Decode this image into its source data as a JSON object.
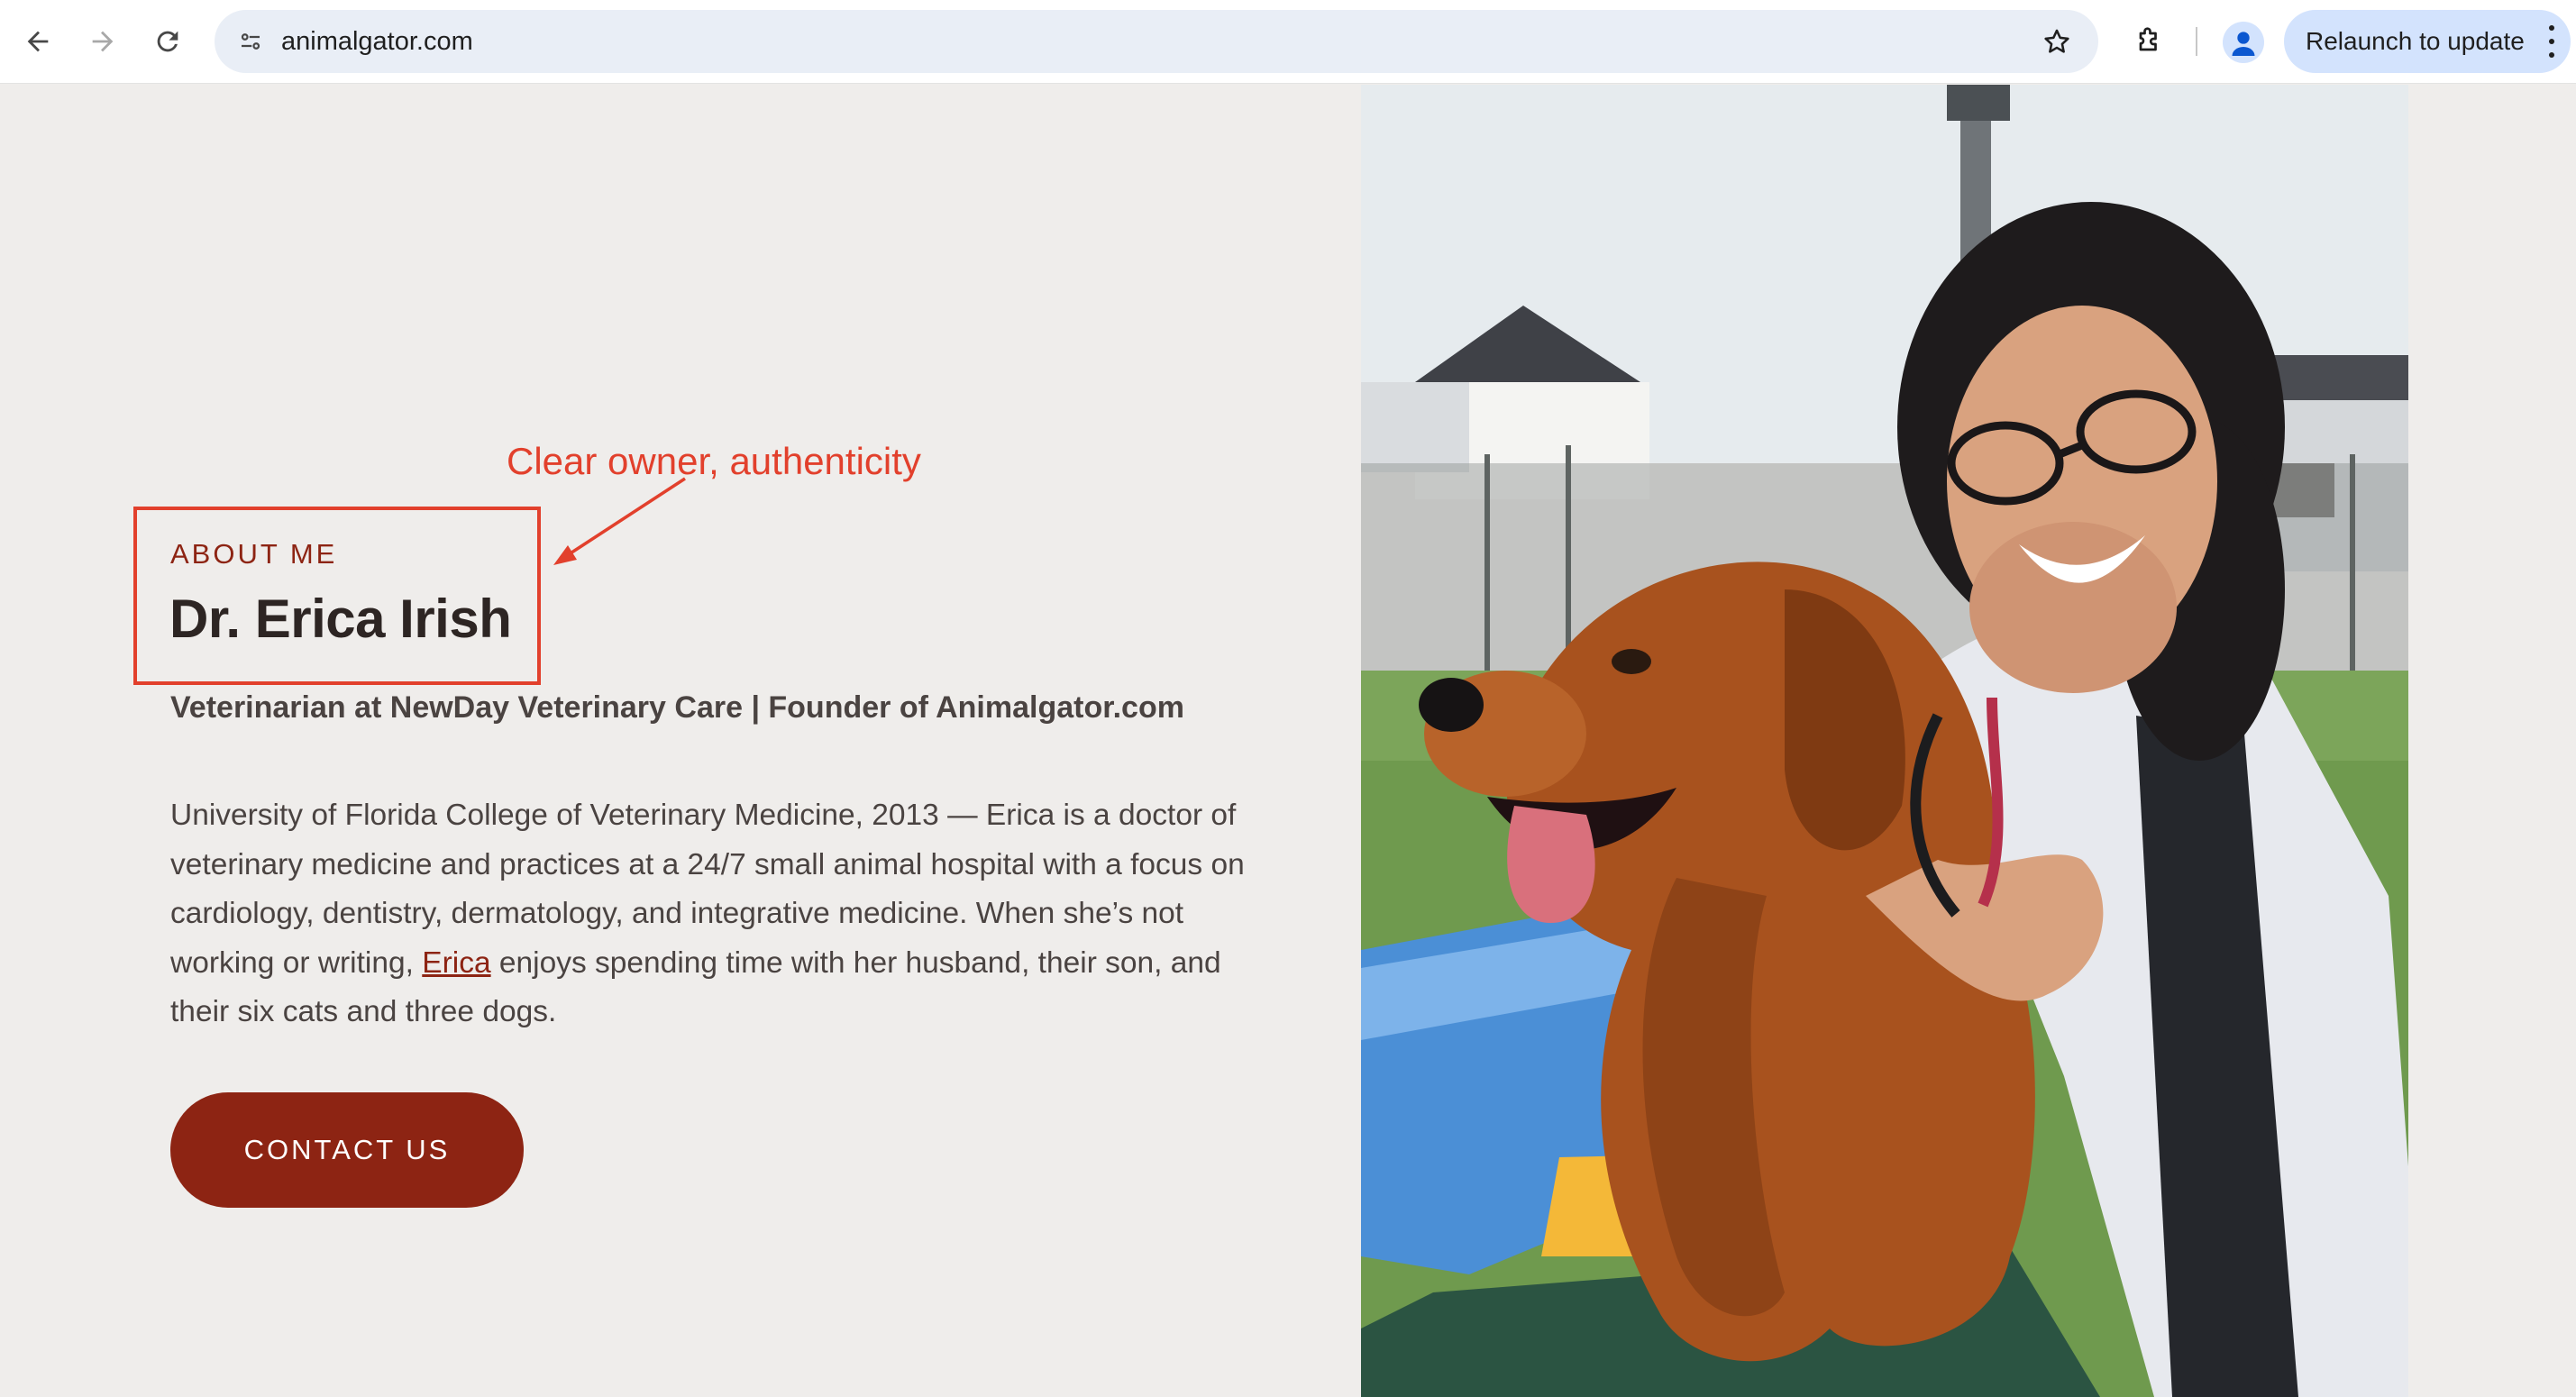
{
  "browser": {
    "url": "animalgator.com",
    "relaunch_label": "Relaunch to update"
  },
  "annotation": {
    "text": "Clear owner, authenticity",
    "color": "#e2402c"
  },
  "about": {
    "eyebrow": "ABOUT ME",
    "name": "Dr. Erica Irish",
    "role": "Veterinarian at NewDay Veterinary Care | Founder of Animalgator.com",
    "bio_before_link": "University of Florida College of Veterinary Medicine, 2013 — Erica is a doctor of veterinary medicine and practices at a 24/7 small animal hospital with a focus on cardiology, dentistry, dermatology, and integrative medicine. When she’s not working or writing, ",
    "bio_link": "Erica",
    "bio_after_link": " enjoys spending time with her husband, their son, and their six cats and three dogs.",
    "contact_label": "CONTACT US"
  },
  "colors": {
    "accent": "#8d2413",
    "page_bg": "#efedeb",
    "annotation": "#e2402c"
  },
  "icons": [
    "back-arrow-icon",
    "forward-arrow-icon",
    "reload-icon",
    "site-info-icon",
    "bookmark-star-icon",
    "extensions-icon",
    "profile-icon",
    "more-vert-icon"
  ]
}
